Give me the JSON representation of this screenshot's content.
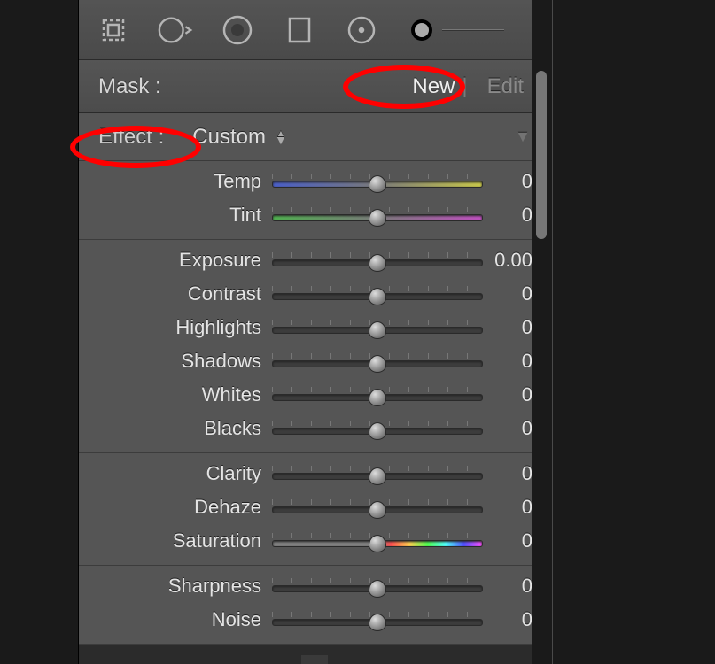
{
  "toolbar": {
    "tools": [
      "crop",
      "radial",
      "spot",
      "gradient",
      "radial2",
      "range"
    ]
  },
  "mask": {
    "label": "Mask :",
    "new_label": "New",
    "edit_label": "Edit"
  },
  "effect": {
    "label": "Effect :",
    "preset": "Custom"
  },
  "groups": [
    {
      "rows": [
        {
          "label": "Temp",
          "value": "0",
          "variant": "temp"
        },
        {
          "label": "Tint",
          "value": "0",
          "variant": "tint"
        }
      ]
    },
    {
      "rows": [
        {
          "label": "Exposure",
          "value": "0.00",
          "variant": "plain"
        },
        {
          "label": "Contrast",
          "value": "0",
          "variant": "plain"
        },
        {
          "label": "Highlights",
          "value": "0",
          "variant": "plain"
        },
        {
          "label": "Shadows",
          "value": "0",
          "variant": "plain"
        },
        {
          "label": "Whites",
          "value": "0",
          "variant": "plain"
        },
        {
          "label": "Blacks",
          "value": "0",
          "variant": "plain"
        }
      ]
    },
    {
      "rows": [
        {
          "label": "Clarity",
          "value": "0",
          "variant": "plain"
        },
        {
          "label": "Dehaze",
          "value": "0",
          "variant": "plain"
        },
        {
          "label": "Saturation",
          "value": "0",
          "variant": "sat"
        }
      ]
    },
    {
      "rows": [
        {
          "label": "Sharpness",
          "value": "0",
          "variant": "plain"
        },
        {
          "label": "Noise",
          "value": "0",
          "variant": "plain"
        }
      ]
    }
  ],
  "annotations": {
    "new_highlighted": true,
    "effect_highlighted": true
  }
}
